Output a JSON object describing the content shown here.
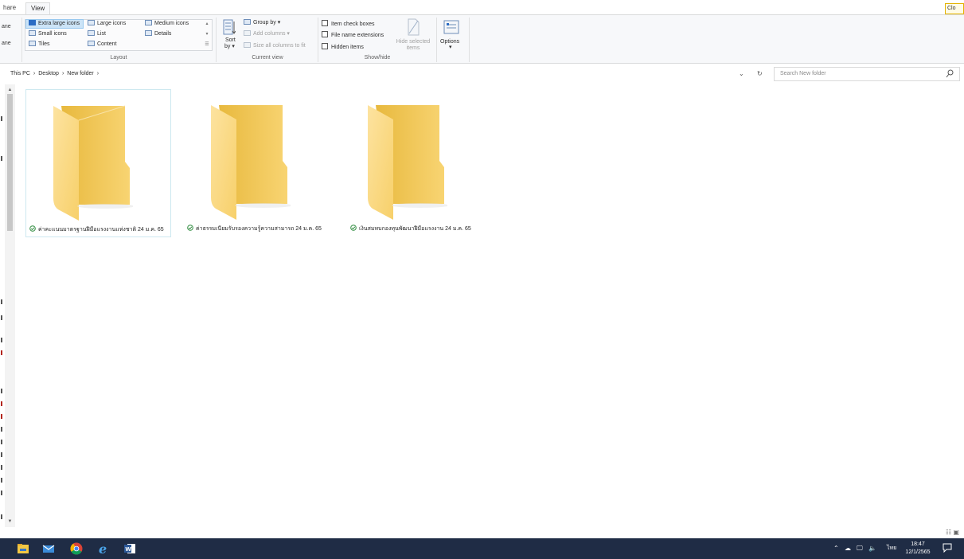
{
  "ribbon_tabs": {
    "share": "hare",
    "view": "View"
  },
  "close_button": "Clo",
  "pane_group": {
    "item1": "ane",
    "item2": "ane"
  },
  "layout": {
    "items": {
      "extra_large": "Extra large icons",
      "large": "Large icons",
      "medium": "Medium icons",
      "small": "Small icons",
      "list": "List",
      "details": "Details",
      "tiles": "Tiles",
      "content": "Content"
    },
    "caption": "Layout"
  },
  "current_view": {
    "sort_line1": "Sort",
    "sort_line2": "by",
    "group_by": "Group by",
    "add_columns": "Add columns",
    "size_all": "Size all columns to fit",
    "caption": "Current view"
  },
  "show_hide": {
    "item_check_boxes": "Item check boxes",
    "file_name_extensions": "File name extensions",
    "hidden_items": "Hidden items",
    "hide_selected_line1": "Hide selected",
    "hide_selected_line2": "items",
    "caption": "Show/hide"
  },
  "options": {
    "label": "Options"
  },
  "address": {
    "crumb1": "This PC",
    "crumb2": "Desktop",
    "crumb3": "New folder"
  },
  "search": {
    "placeholder": "Search New folder"
  },
  "folders": [
    {
      "name": "ค่าคะแนนมาตรฐานฝีมือแรงงานแห่งชาติ 24 ม.ค. 65"
    },
    {
      "name": "ค่าธรรมเนียมรับรองความรู้ความสามารถ 24 ม.ค. 65"
    },
    {
      "name": "เงินสมทบกองทุนพัฒนาฝีมือแรงงาน 24 ม.ค. 65"
    }
  ],
  "tray": {
    "language": "ไทย",
    "time": "18:47",
    "date": "12/1/2565"
  },
  "colors": {
    "accent": "#2b6cc4",
    "taskbar": "#1f2c45",
    "folder": "#f8d775",
    "selection": "#cce4f7"
  }
}
